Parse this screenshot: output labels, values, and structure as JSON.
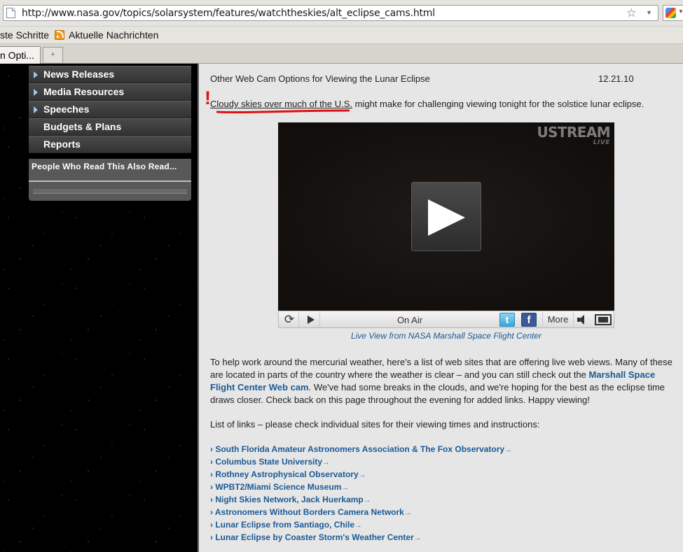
{
  "browser": {
    "url": "http://www.nasa.gov/topics/solarsystem/features/watchtheskies/alt_eclipse_cams.html",
    "bookmarks": [
      "ste Schritte",
      "Aktuelle Nachrichten"
    ],
    "active_tab_label": "n Opti...",
    "new_tab_glyph": "+"
  },
  "sidebar": {
    "nav_items": [
      {
        "label": "News Releases",
        "arrow": true
      },
      {
        "label": "Media Resources",
        "arrow": true
      },
      {
        "label": "Speeches",
        "arrow": true
      },
      {
        "label": "Budgets & Plans",
        "arrow": false
      },
      {
        "label": "Reports",
        "arrow": false
      }
    ],
    "read_also_title": "People Who Read This Also Read..."
  },
  "article": {
    "title": "Other Web Cam Options for Viewing the Lunar Eclipse",
    "date": "12.21.10",
    "annotation_mark": "!",
    "intro_highlight": "Cloudy skies over much of the U.S.",
    "intro_rest": " might make for challenging viewing tonight for the solstice lunar eclipse.",
    "player": {
      "logo": "USTREAM",
      "logo_sub": "LIVE",
      "status": "On Air",
      "more_label": "More",
      "twitter_glyph": "t",
      "facebook_glyph": "f",
      "refresh_glyph": "⟳"
    },
    "caption": "Live View from NASA Marshall Space Flight Center",
    "para_part1": "To help work around the mercurial weather, here's a list of web sites that are offering live web views. Many of these are located in parts of the country where the weather is clear – and you can still check out the ",
    "para_link": "Marshall Space Flight Center Web cam",
    "para_part2": ". We've had some breaks in the clouds, and we're hoping for the best as the eclipse time draws closer. Check back on this page throughout the evening for added links. Happy viewing!",
    "list_heading": "List of links – please check individual sites for their viewing times and instructions:",
    "link_prefix": "›",
    "link_arrow": "→",
    "links": [
      "South Florida Amateur Astronomers Association & The Fox Observatory",
      "Columbus State University",
      "Rothney Astrophysical Observatory",
      "WPBT2/Miami Science Museum",
      "Night Skies Network, Jack Huerkamp",
      "Astronomers Without Borders Camera Network",
      "Lunar Eclipse from Santiago, Chile",
      "Lunar Eclipse by Coaster Storm's Weather Center"
    ]
  },
  "colors": {
    "link_blue": "#1b5a96",
    "annotation_red": "#e01010",
    "nav_arrow": "#9fc6ea"
  }
}
